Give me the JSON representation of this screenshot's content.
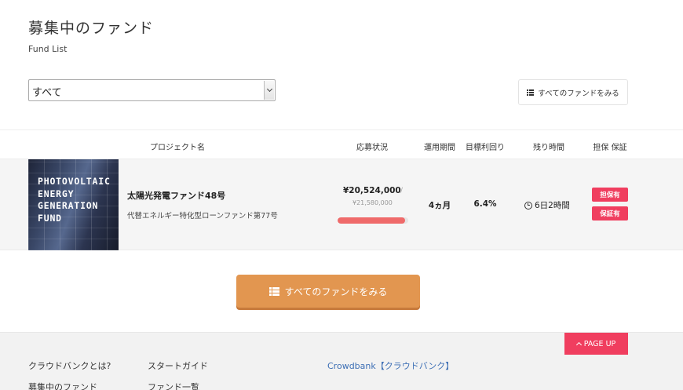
{
  "header": {
    "title": "募集中のファンド",
    "subtitle": "Fund List"
  },
  "filter": {
    "selected": "すべて"
  },
  "actions": {
    "all_funds_label": "すべてのファンドをみる",
    "all_funds_large_label": "すべてのファンドをみる"
  },
  "table": {
    "headers": {
      "project": "プロジェクト名",
      "status": "応募状況",
      "term": "運用期間",
      "yield": "目標利回り",
      "remaining": "残り時間",
      "security": "担保 保証"
    }
  },
  "fund": {
    "image_text": "PHOTOVOLTAIC\nENERGY\nGENERATION\nFUND",
    "name": "太陽光発電ファンド48号",
    "description": "代替エネルギー特化型ローンファンド第77号",
    "raised": "¥20,524,000",
    "separator": "/",
    "target": "¥21,580,000",
    "progress_fraction": 0.951,
    "term": "4ヵ月",
    "yield": "6.4%",
    "remaining": "6日2時間",
    "badges": [
      "担保有",
      "保証有"
    ],
    "badge_color": "#f03e5f",
    "progress_color": "#ef6a6a"
  },
  "footer": {
    "page_up": "PAGE UP",
    "links": [
      "クラウドバンクとは?",
      "スタートガイド",
      "募集中のファンド",
      "ファンド一覧"
    ],
    "brand": "Crowdbank【クラウドバンク】"
  },
  "colors": {
    "accent_orange": "#e29650",
    "accent_red": "#f03e5f",
    "link_blue": "#3d6fb5"
  }
}
